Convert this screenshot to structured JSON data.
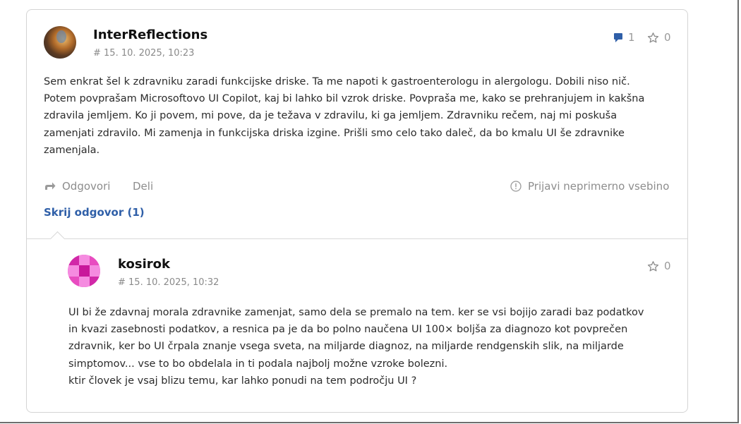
{
  "comment": {
    "author": "InterReflections",
    "timestamp": "# 15. 10. 2025, 10:23",
    "reply_count": "1",
    "like_count": "0",
    "lines": [
      "Sem enkrat šel k zdravniku zaradi funkcijske driske. Ta me napoti k gastroenterologu in alergologu. Dobili niso nič.",
      "Potem povprašam Microsoftovo UI Copilot, kaj bi lahko bil vzrok driske. Povpraša me, kako se prehranjujem in kakšna",
      "zdravila jemljem. Ko ji povem, mi pove, da je težava v zdravilu, ki ga jemljem. Zdravniku rečem, naj mi poskuša",
      "zamenjati zdravilo. Mi zamenja in funkcijska driska izgine. Prišli smo celo tako daleč, da bo kmalu UI še zdravnike",
      "zamenjala."
    ],
    "actions": {
      "reply_label": "Odgovori",
      "share_label": "Deli",
      "report_label": "Prijavi neprimerno vsebino",
      "hide_replies_label": "Skrij odgovor (1)"
    }
  },
  "reply": {
    "author": "kosirok",
    "timestamp": "# 15. 10. 2025, 10:32",
    "like_count": "0",
    "lines": [
      "UI bi že zdavnaj morala zdravnike zamenjat, samo dela se premalo na tem. ker se vsi bojijo zaradi baz podatkov",
      "in kvazi zasebnosti podatkov, a resnica pa je da bo polno naučena UI 100× boljša za diagnozo kot povprečen",
      "zdravnik, ker bo UI črpala znanje vsega sveta, na miljarde diagnoz, na miljarde rendgenskih slik, na miljarde",
      "simptomov... vse to bo obdelala in ti podala najbolj možne vzroke bolezni.",
      "ktir človek je vsaj blizu temu, kar lahko ponudi na tem področju UI ?"
    ]
  },
  "colors": {
    "accent_blue": "#2f5fa8",
    "avatar_pink": "#e84cc0"
  }
}
